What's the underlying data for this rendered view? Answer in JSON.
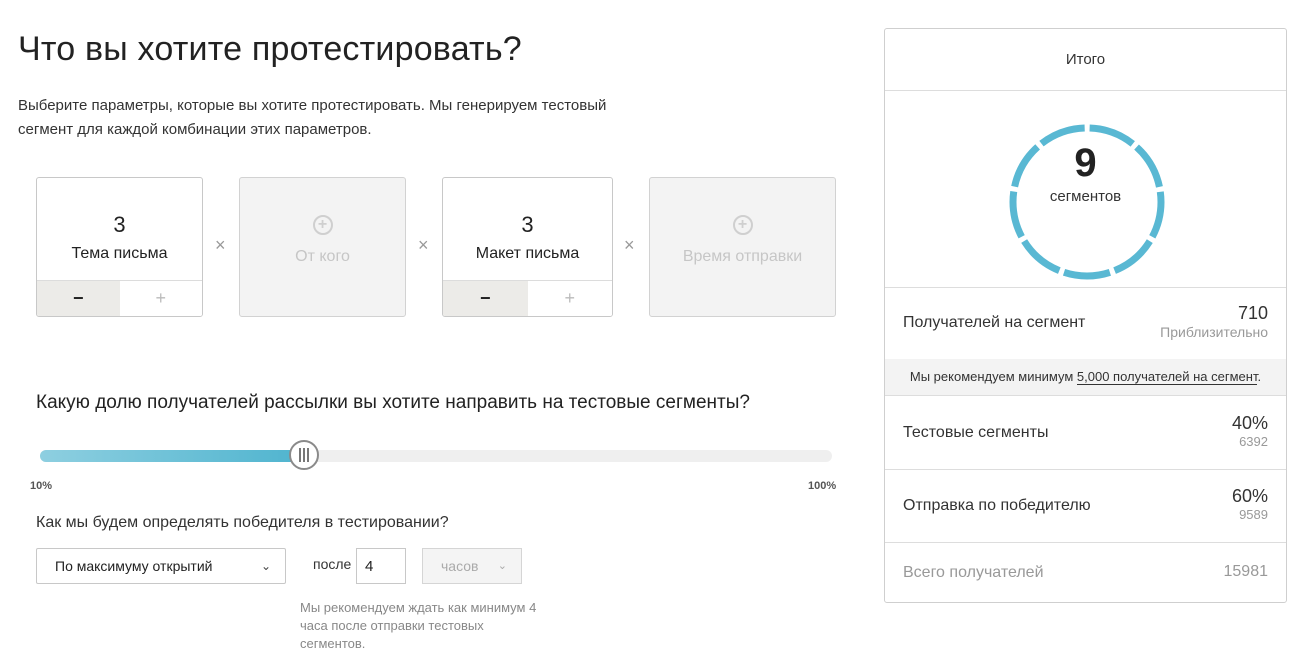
{
  "header": {
    "title": "Что вы хотите протестировать?",
    "intro": "Выберите параметры, которые вы хотите протестировать. Мы генерируем тестовый сегмент для каждой комбинации этих параметров."
  },
  "variables": [
    {
      "count": "3",
      "label": "Тема письма",
      "active": true,
      "minus": "−",
      "plus": "+"
    },
    {
      "label": "От кого",
      "active": false,
      "add_icon": "plus-circle-icon"
    },
    {
      "count": "3",
      "label": "Макет письма",
      "active": true,
      "minus": "−",
      "plus": "+"
    },
    {
      "label": "Время отправки",
      "active": false,
      "add_icon": "plus-circle-icon"
    }
  ],
  "times_sign": "×",
  "split": {
    "question": "Какую долю получателей рассылки вы хотите направить на тестовые сегменты?",
    "min_label": "10%",
    "max_label": "100%",
    "value": 40,
    "min": 10,
    "max": 100
  },
  "winner": {
    "question": "Как мы будем определять победителя в тестировании?",
    "metric": "По максимуму открытий",
    "after_label": "после",
    "hours_value": "4",
    "unit": "часов",
    "recommendation": "Мы рекомендуем ждать как минимум 4 часа после отправки тестовых сегментов."
  },
  "summary": {
    "title": "Итого",
    "segments_count": "9",
    "segments_label": "сегментов",
    "ring_segments": 9,
    "ring_color": "#59b8d3",
    "per_segment_label": "Получателей на сегмент",
    "per_segment_value": "710",
    "per_segment_sub": "Приблизительно",
    "note_prefix": "Мы рекомендуем минимум ",
    "note_link": "5,000 получателей на сегмент",
    "note_suffix": ".",
    "test_label": "Тестовые сегменты",
    "test_pct": "40%",
    "test_count": "6392",
    "winner_label": "Отправка по победителю",
    "winner_pct": "60%",
    "winner_count": "9589",
    "total_label": "Всего получателей",
    "total_value": "15981"
  }
}
